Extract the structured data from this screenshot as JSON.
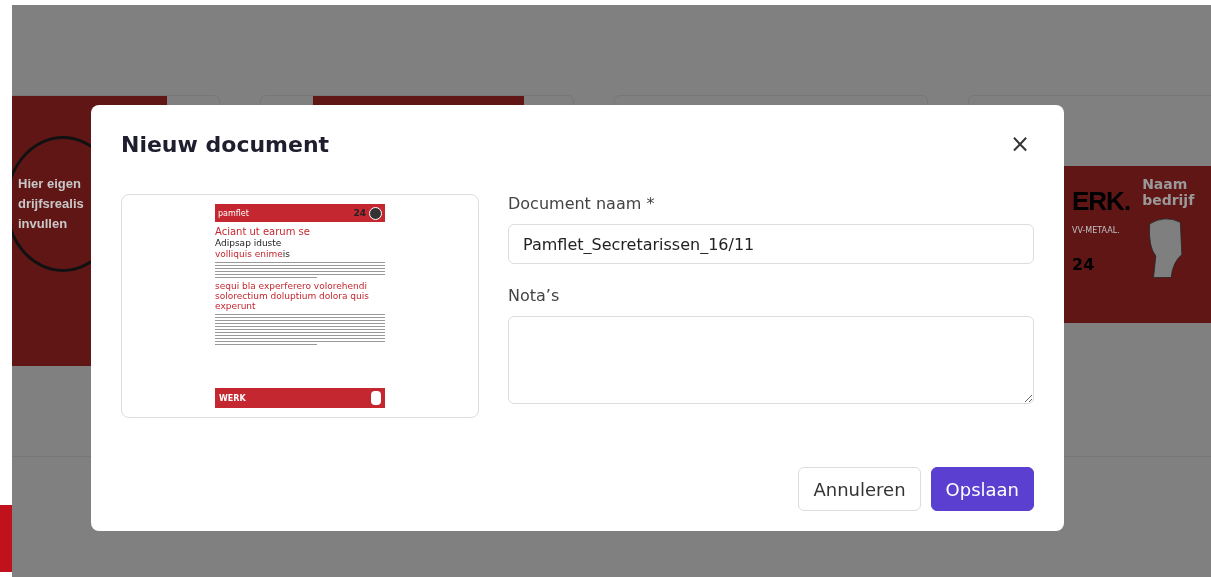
{
  "background": {
    "left_card": {
      "circle_text": [
        "Hier eigen",
        "drijfsrealis",
        "invullen"
      ]
    },
    "right_card": {
      "logo_text": "ERK.",
      "subtitle": "VV-METAAL.",
      "number": "24",
      "name_text": [
        "Naam",
        "bedrijf"
      ]
    }
  },
  "dialog": {
    "title": "Nieuw document",
    "close": "×",
    "preview": {
      "header_label": "pamflet",
      "header_number": "24",
      "heading": "Aciant ut earum se",
      "subheading": "Adipsap iduste",
      "subheading_red": "volliquis enime",
      "subheading_tail": "is",
      "section_heading": "sequi bla experferero volorehendi solorectium doluptium dolora quis experunt",
      "footer_logo": "WERK"
    },
    "fields": [
      {
        "kind": "input",
        "label": "Document naam *",
        "value": "Pamflet_Secretarissen_16/11"
      },
      {
        "kind": "textarea",
        "label": "Nota’s"
      }
    ],
    "buttons": [
      {
        "label": "Annuleren",
        "kind": "secondary"
      },
      {
        "label": "Opslaan",
        "kind": "primary"
      }
    ]
  }
}
